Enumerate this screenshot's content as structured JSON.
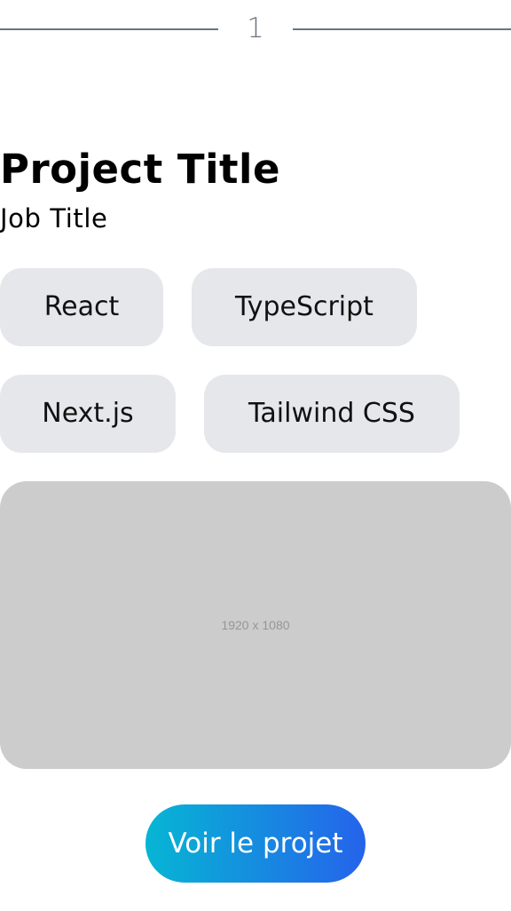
{
  "divider": {
    "number": "1"
  },
  "project": {
    "title": "Project Title",
    "job_title": "Job Title"
  },
  "tags": [
    {
      "label": "React"
    },
    {
      "label": "TypeScript"
    },
    {
      "label": "Next.js"
    },
    {
      "label": "Tailwind CSS"
    }
  ],
  "image": {
    "placeholder_text": "1920 x 1080"
  },
  "cta": {
    "label": "Voir le projet"
  },
  "colors": {
    "divider": "#6b7580",
    "tag_background": "#e5e7eb",
    "placeholder_background": "#cccccc",
    "cta_gradient_start": "#06b6d4",
    "cta_gradient_end": "#2563eb",
    "cta_text": "#ffffff"
  }
}
